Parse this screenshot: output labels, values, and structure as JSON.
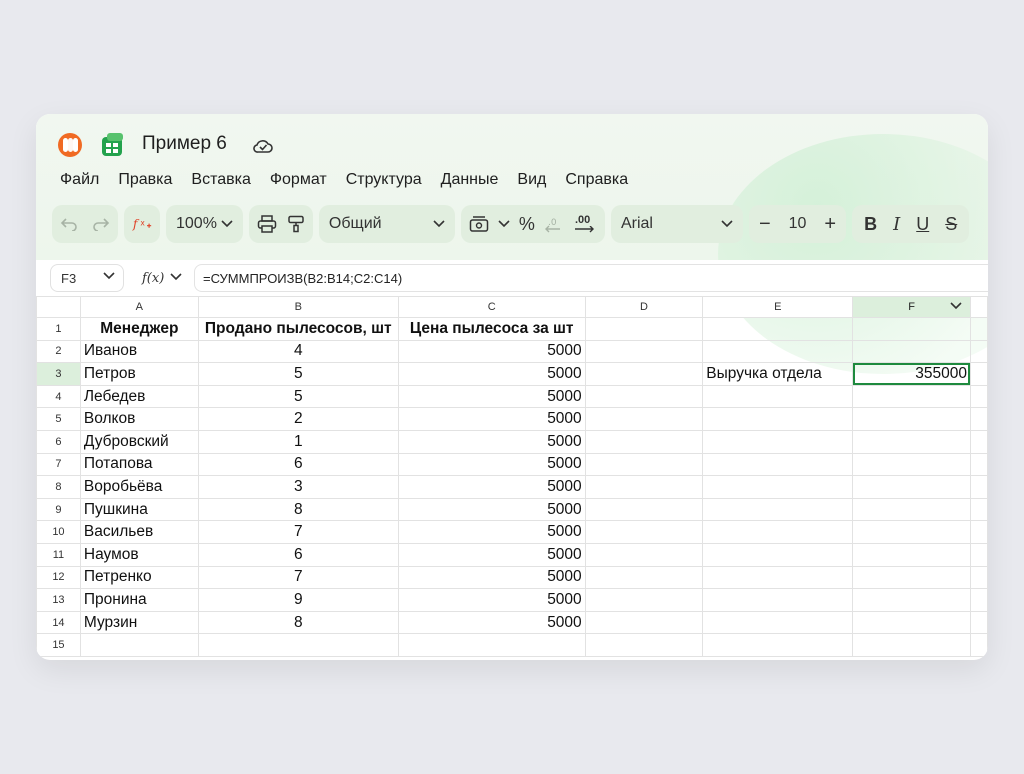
{
  "doc": {
    "title": "Пример 6"
  },
  "menu": [
    "Файл",
    "Правка",
    "Вставка",
    "Формат",
    "Структура",
    "Данные",
    "Вид",
    "Справка"
  ],
  "toolbar": {
    "zoom": "100%",
    "number_format": "Общий",
    "percent": "%",
    "decimal_inc": ".00",
    "font": "Arial",
    "font_size": "10",
    "bold": "B",
    "italic": "I",
    "underline": "U",
    "strike": "S"
  },
  "formula_bar": {
    "cell_ref": "F3",
    "fx_label": "f(x)",
    "formula": "=СУММПРОИЗВ(B2:B14;C2:C14)"
  },
  "grid": {
    "columns": [
      "A",
      "B",
      "C",
      "D",
      "E",
      "F"
    ],
    "selected_column": "F",
    "selected_row": 3,
    "headers": [
      "Менеджер",
      "Продано пылесосов, шт",
      "Цена пылесоса за шт"
    ],
    "rows": [
      {
        "n": "2",
        "a": "Иванов",
        "b": "4",
        "c": "5000"
      },
      {
        "n": "3",
        "a": "Петров",
        "b": "5",
        "c": "5000"
      },
      {
        "n": "4",
        "a": "Лебедев",
        "b": "5",
        "c": "5000"
      },
      {
        "n": "5",
        "a": "Волков",
        "b": "2",
        "c": "5000"
      },
      {
        "n": "6",
        "a": "Дубровский",
        "b": "1",
        "c": "5000"
      },
      {
        "n": "7",
        "a": "Потапова",
        "b": "6",
        "c": "5000"
      },
      {
        "n": "8",
        "a": "Воробьёва",
        "b": "3",
        "c": "5000"
      },
      {
        "n": "9",
        "a": "Пушкина",
        "b": "8",
        "c": "5000"
      },
      {
        "n": "10",
        "a": "Васильев",
        "b": "7",
        "c": "5000"
      },
      {
        "n": "11",
        "a": "Наумов",
        "b": "6",
        "c": "5000"
      },
      {
        "n": "12",
        "a": "Петренко",
        "b": "7",
        "c": "5000"
      },
      {
        "n": "13",
        "a": "Пронина",
        "b": "9",
        "c": "5000"
      },
      {
        "n": "14",
        "a": "Мурзин",
        "b": "8",
        "c": "5000"
      }
    ],
    "e3": "Выручка отдела",
    "f3": "355000",
    "last_row": "15"
  },
  "colors": {
    "accent": "#1e8a3e",
    "selection_bg": "#dcefdc",
    "toolbar_bg": "#e1eedf"
  },
  "icons": [
    "undo-icon",
    "redo-icon",
    "function-insert-icon",
    "print-icon",
    "paint-format-icon",
    "currency-format-icon",
    "decimal-decrease-icon",
    "decimal-increase-icon",
    "cloud-icon"
  ]
}
